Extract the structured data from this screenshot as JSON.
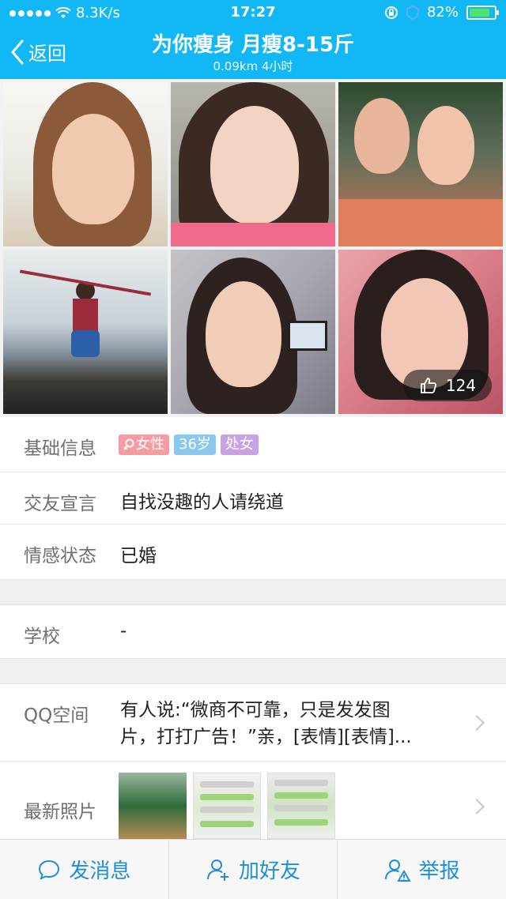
{
  "status_bar": {
    "network_speed": "8.3K/s",
    "time": "17:27",
    "battery_percent": "82%",
    "battery_level": 0.82
  },
  "nav": {
    "back_label": "返回",
    "title": "为你瘦身 月瘦8-15斤",
    "subtitle": "0.09km 4小时"
  },
  "photos": {
    "like_count": "124"
  },
  "profile": {
    "basic": {
      "label": "基础信息",
      "tags": [
        "女性",
        "36岁",
        "处女"
      ]
    },
    "declaration": {
      "label": "交友宣言",
      "value": "自找没趣的人请绕道"
    },
    "relationship": {
      "label": "情感状态",
      "value": "已婚"
    },
    "school": {
      "label": "学校",
      "value": "-"
    },
    "qzone": {
      "label": "QQ空间",
      "line1": "有人说:“微商不可靠，只是发发图",
      "line2": "片，打打广告！”亲，[表情][表情]..."
    },
    "latest_photos": {
      "label": "最新照片"
    }
  },
  "actions": {
    "message": "发消息",
    "add_friend": "加好友",
    "report": "举报"
  },
  "colors": {
    "header_bg": "#12b7f5",
    "action_text": "#1e8fd8",
    "tag_gender": "#f59ba3",
    "tag_age": "#8bc8ee",
    "tag_other": "#c7a3e3"
  }
}
